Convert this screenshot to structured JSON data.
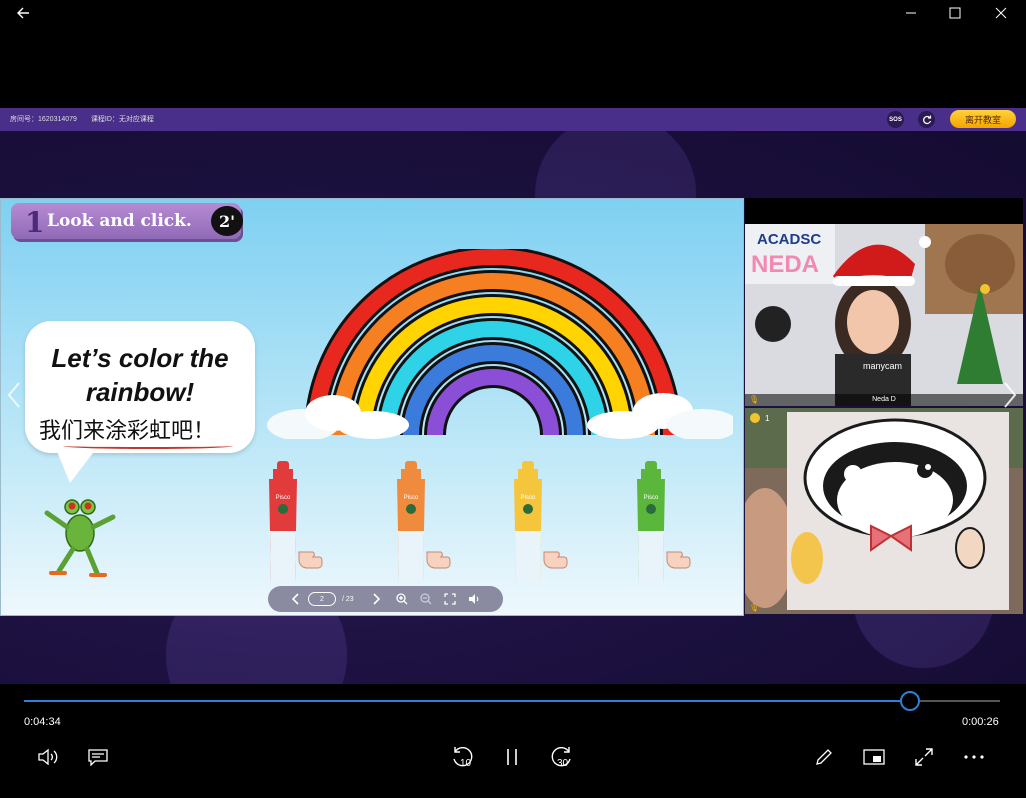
{
  "window": {
    "back_icon": "arrow-left-icon",
    "minimize_icon": "minimize-icon",
    "maximize_icon": "maximize-icon",
    "close_icon": "close-icon"
  },
  "classroom": {
    "room_label": "房间号：1620314079",
    "course_label": "课程ID：无对应课程",
    "sos_label": "SOS",
    "leave_label": "离开教室",
    "accent": "#4a2f8a",
    "leave_color": "#f4a400"
  },
  "slide": {
    "number": "1",
    "title": "Look and click.",
    "badge": "2'",
    "bubble_en": "Let’s color the\nrainbow!",
    "bubble_zh": "我们来涂彩虹吧！",
    "rainbow_colors": [
      "#e8281e",
      "#f57f21",
      "#ffd400",
      "#2fd3e8",
      "#3b7bdc",
      "#8a4fd6"
    ],
    "tube_colors": [
      "#e23b3b",
      "#f08a3c",
      "#f5c53c",
      "#5bb63c"
    ],
    "tube_brand": "Pisco"
  },
  "pager": {
    "current_page": "2",
    "total_pages": "/ 23",
    "prev_icon": "chevron-left-icon",
    "next_icon": "chevron-right-icon",
    "zoom_in_icon": "zoom-in-icon",
    "zoom_out_icon": "zoom-out-icon",
    "fullscreen_icon": "fullscreen-icon",
    "audio_icon": "speaker-icon"
  },
  "videos": {
    "teacher_name": "Neda D",
    "teacher_banner": "ACADSC",
    "teacher_banner_name": "NEDA",
    "watermark": "manycam",
    "student_stars": "1"
  },
  "player": {
    "elapsed": "0:04:34",
    "remaining": "0:00:26",
    "progress": 0.908,
    "accent": "#2f7fd6",
    "rewind_label": "10",
    "forward_label": "30"
  }
}
